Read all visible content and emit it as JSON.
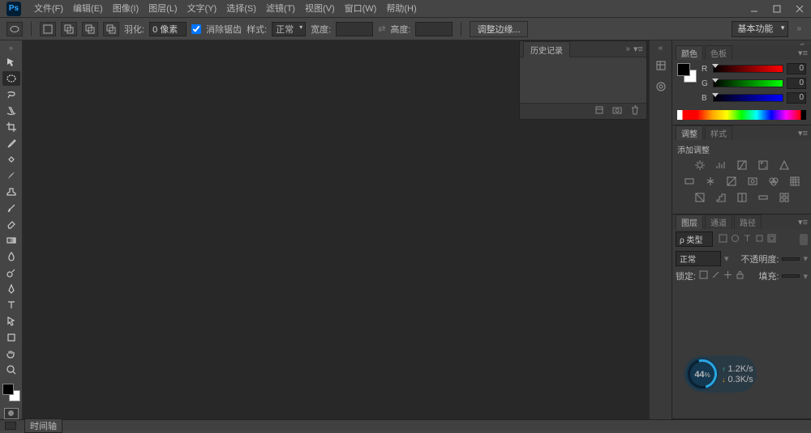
{
  "app": {
    "logo": "Ps"
  },
  "menu": [
    {
      "k": "file",
      "label": "文件(F)"
    },
    {
      "k": "edit",
      "label": "编辑(E)"
    },
    {
      "k": "image",
      "label": "图像(I)"
    },
    {
      "k": "layer",
      "label": "图层(L)"
    },
    {
      "k": "type",
      "label": "文字(Y)"
    },
    {
      "k": "select",
      "label": "选择(S)"
    },
    {
      "k": "filter",
      "label": "滤镜(T)"
    },
    {
      "k": "view",
      "label": "视图(V)"
    },
    {
      "k": "window",
      "label": "窗口(W)"
    },
    {
      "k": "help",
      "label": "帮助(H)"
    }
  ],
  "options": {
    "feather_label": "羽化:",
    "feather_value": "0 像素",
    "antialias_label": "消除锯齿",
    "style_label": "样式:",
    "style_value": "正常",
    "width_label": "宽度:",
    "width_value": "",
    "height_label": "高度:",
    "height_value": "",
    "refine_edge": "调整边缘...",
    "workspace": "基本功能"
  },
  "history": {
    "tab": "历史记录"
  },
  "color": {
    "tab_color": "颜色",
    "tab_swatches": "色板",
    "r_label": "R",
    "g_label": "G",
    "b_label": "B",
    "r": "0",
    "g": "0",
    "b": "0"
  },
  "adjust": {
    "tab_adjust": "调整",
    "tab_style": "样式",
    "title": "添加调整"
  },
  "layers": {
    "tab_layers": "图层",
    "tab_channels": "通道",
    "tab_paths": "路径",
    "filter_kind": "ρ 类型",
    "blend_mode": "正常",
    "opacity_label": "不透明度:",
    "lock_label": "锁定:",
    "fill_label": "填充:"
  },
  "net": {
    "pct": "44",
    "pct_suffix": "%",
    "up": "1.2K/s",
    "down": "0.3K/s"
  },
  "status": {
    "timeline": "时间轴"
  }
}
